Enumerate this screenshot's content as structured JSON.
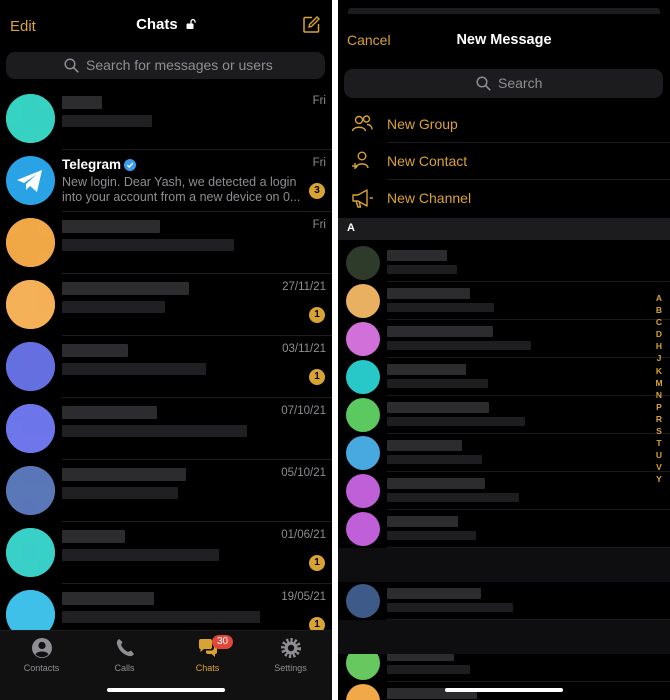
{
  "left": {
    "header": {
      "edit_label": "Edit",
      "title": "Chats"
    },
    "search": {
      "placeholder": "Search for messages or users"
    },
    "chats": [
      {
        "name": "",
        "message": "",
        "date": "Fri",
        "badge": "",
        "avatar_color": "#37d2c2"
      },
      {
        "name": "Telegram",
        "message": "New login. Dear Yash, we detected a login into your account from a new device on 0...",
        "date": "Fri",
        "badge": "3",
        "avatar_color": "#2aa3e6"
      },
      {
        "name": "",
        "message": "",
        "date": "Fri",
        "badge": "",
        "avatar_color": "#f0a848"
      },
      {
        "name": "",
        "message": "",
        "date": "27/11/21",
        "badge": "1",
        "avatar_color": "#f5b158"
      },
      {
        "name": "",
        "message": "",
        "date": "03/11/21",
        "badge": "1",
        "avatar_color": "#6670e0"
      },
      {
        "name": "",
        "message": "",
        "date": "07/10/21",
        "badge": "",
        "avatar_color": "#6e76ea"
      },
      {
        "name": "",
        "message": "",
        "date": "05/10/21",
        "badge": "",
        "avatar_color": "#5a78b8"
      },
      {
        "name": "",
        "message": "",
        "date": "01/06/21",
        "badge": "1",
        "avatar_color": "#3ad0c8"
      },
      {
        "name": "",
        "message": "",
        "date": "19/05/21",
        "badge": "1",
        "avatar_color": "#3fc0e8"
      }
    ],
    "tabs": [
      {
        "label": "Contacts",
        "icon": "person-circle-icon",
        "active": false
      },
      {
        "label": "Calls",
        "icon": "phone-icon",
        "active": false
      },
      {
        "label": "Chats",
        "icon": "chat-bubbles-icon",
        "active": true,
        "badge": "30"
      },
      {
        "label": "Settings",
        "icon": "gear-icon",
        "active": false
      }
    ]
  },
  "right": {
    "header": {
      "cancel_label": "Cancel",
      "title": "New Message"
    },
    "search": {
      "placeholder": "Search"
    },
    "actions": [
      {
        "label": "New Group",
        "icon": "group-icon"
      },
      {
        "label": "New Contact",
        "icon": "add-contact-icon"
      },
      {
        "label": "New Channel",
        "icon": "megaphone-icon"
      }
    ],
    "section_letter": "A",
    "contacts": [
      {
        "avatar_color": "#2e3a2a"
      },
      {
        "avatar_color": "#e8b060"
      },
      {
        "avatar_color": "#d070d8"
      },
      {
        "avatar_color": "#28c8c8"
      },
      {
        "avatar_color": "#5cc860"
      },
      {
        "avatar_color": "#48a8e0"
      },
      {
        "avatar_color": "#c060d8"
      },
      {
        "avatar_color": "#c060d8"
      },
      {
        "avatar_color": "#3d5a88"
      },
      {
        "avatar_color": "#68c860"
      },
      {
        "avatar_color": "#f0a848"
      }
    ],
    "index_letters": [
      "A",
      "B",
      "C",
      "D",
      "H",
      "J",
      "K",
      "M",
      "N",
      "P",
      "R",
      "S",
      "T",
      "U",
      "V",
      "Y"
    ]
  },
  "colors": {
    "accent": "#d9a333",
    "background": "#000000",
    "search_bg": "#1c1c1e",
    "secondary_text": "#8e8e93"
  }
}
